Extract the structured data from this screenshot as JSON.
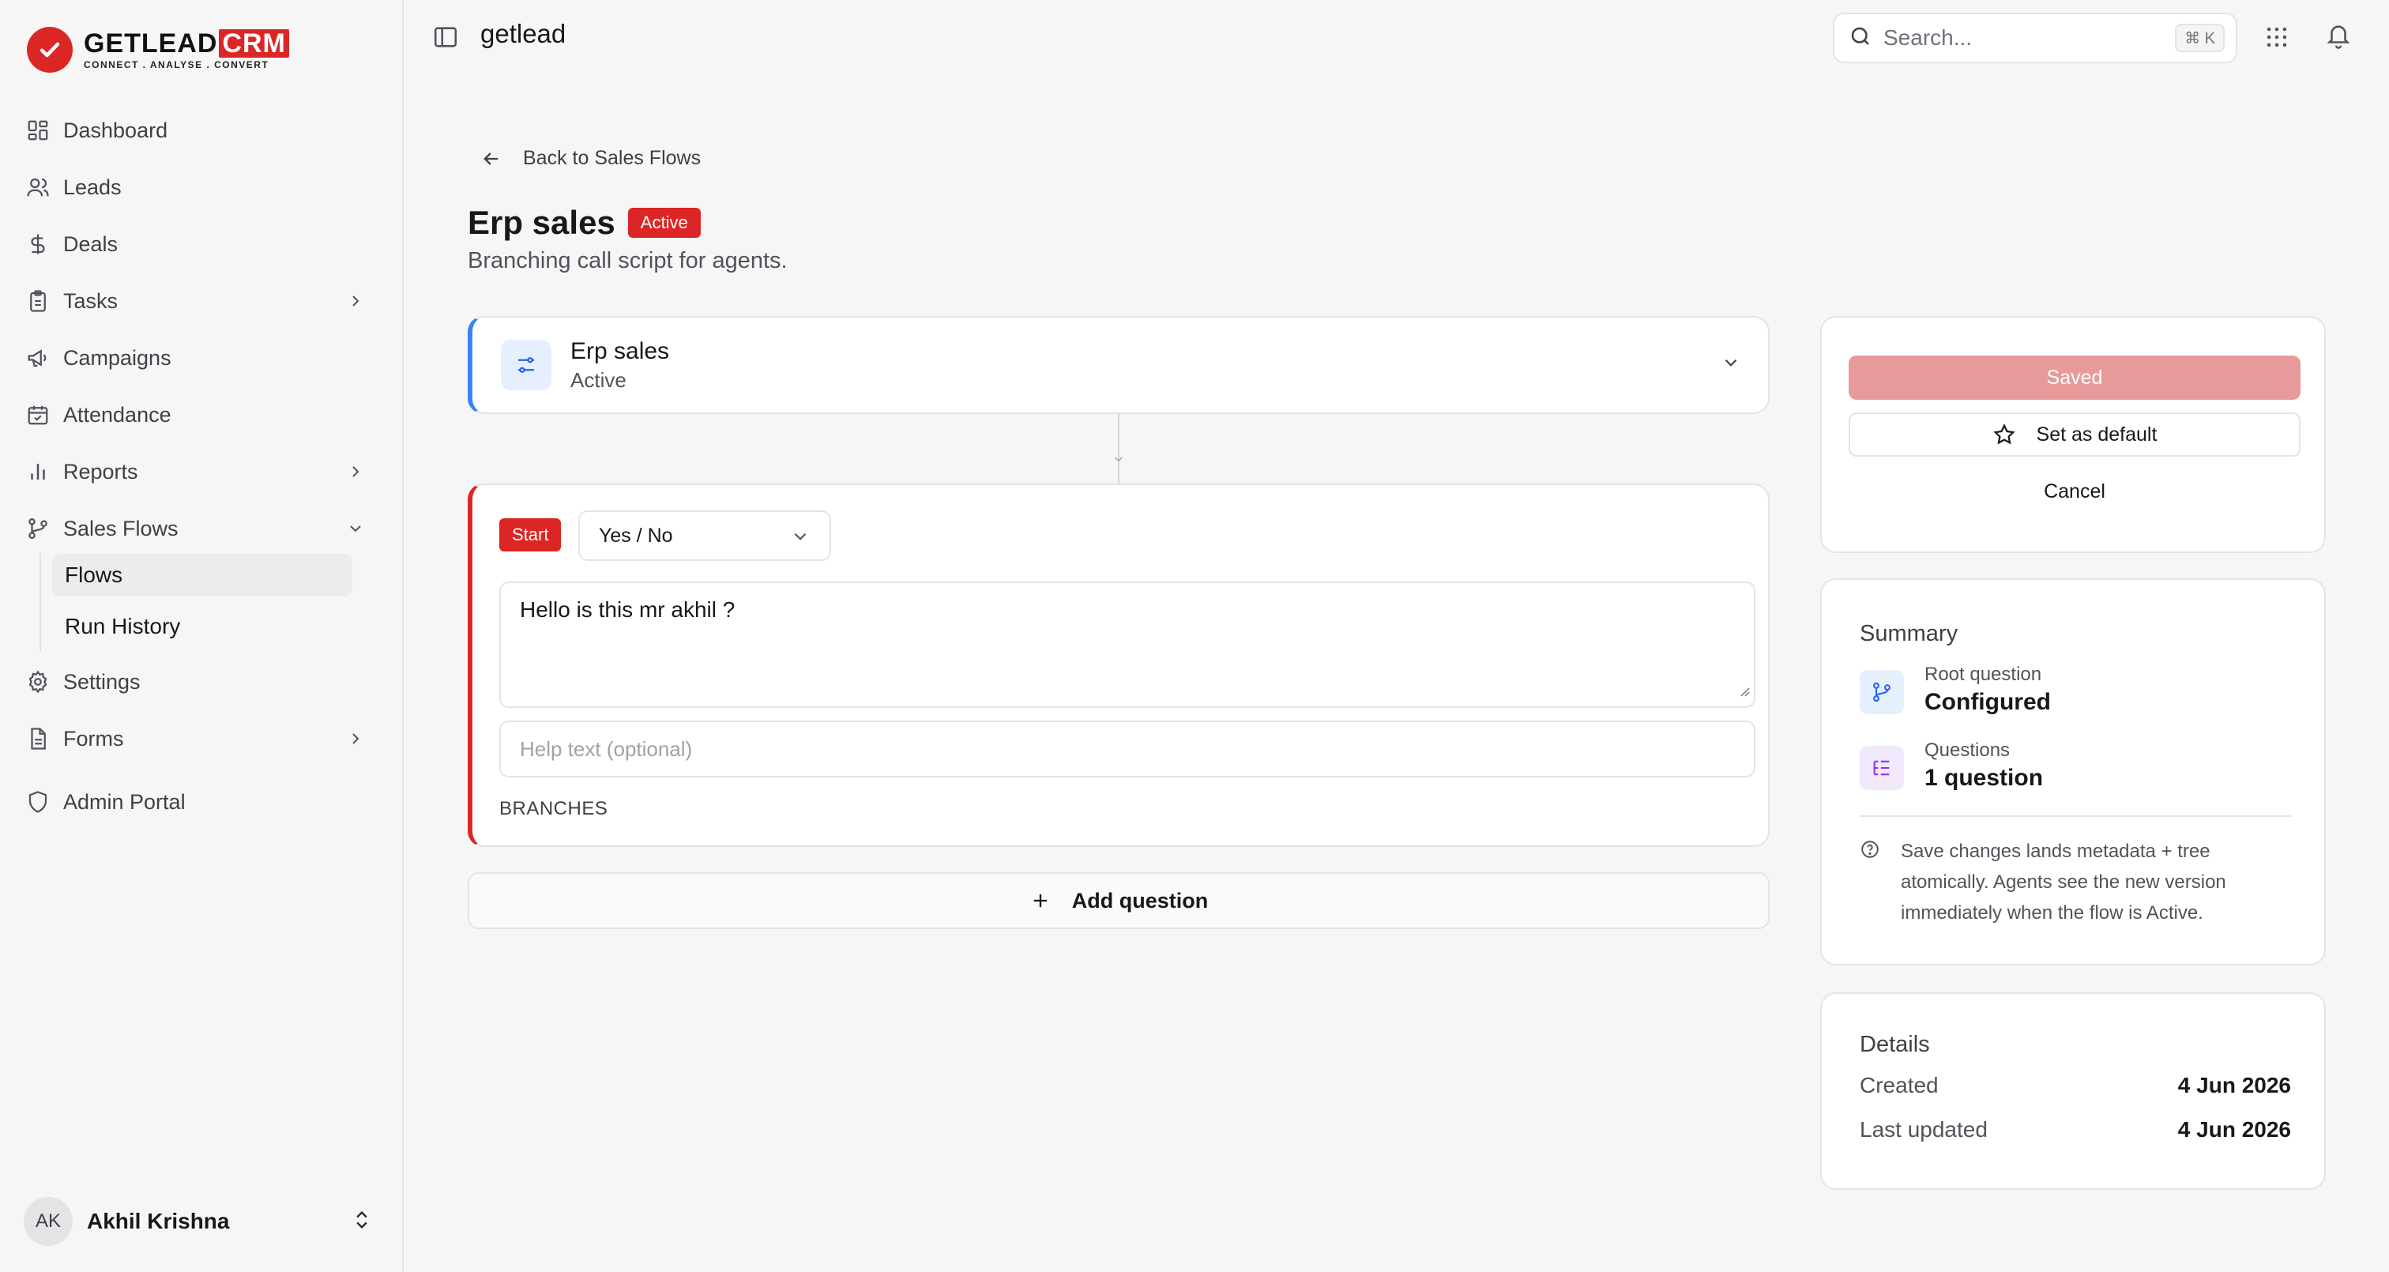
{
  "brand": {
    "logo_word": "GETLEAD",
    "logo_crm": "CRM",
    "logo_tagline": "CONNECT . ANALYSE . CONVERT",
    "workspace_name": "getlead",
    "accent": "#dc2626"
  },
  "sidebar": {
    "items": [
      {
        "label": "Dashboard",
        "icon": "grid-icon"
      },
      {
        "label": "Leads",
        "icon": "users-icon"
      },
      {
        "label": "Deals",
        "icon": "dollar-icon"
      },
      {
        "label": "Tasks",
        "icon": "clipboard-icon"
      },
      {
        "label": "Campaigns",
        "icon": "megaphone-icon"
      },
      {
        "label": "Attendance",
        "icon": "calendar-icon"
      },
      {
        "label": "Reports",
        "icon": "bar-chart-icon"
      },
      {
        "label": "Sales Flows",
        "icon": "branch-icon"
      },
      {
        "label": "Settings",
        "icon": "gear-icon"
      },
      {
        "label": "Forms",
        "icon": "document-icon"
      },
      {
        "label": "Admin Portal",
        "icon": "shield-icon"
      }
    ],
    "sub_items": [
      {
        "label": "Flows",
        "active": true
      },
      {
        "label": "Run History",
        "active": false
      }
    ],
    "user": {
      "initials": "AK",
      "name": "Akhil Krishna"
    }
  },
  "topbar": {
    "search_placeholder": "Search...",
    "shortcut": "⌘ K"
  },
  "main": {
    "back_label": "Back to Sales Flows",
    "title": "Erp sales",
    "status_badge": "Active",
    "subtitle": "Branching call script for agents.",
    "flow_card": {
      "name": "Erp sales",
      "status": "Active"
    },
    "question": {
      "start_badge": "Start",
      "type_value": "Yes / No",
      "text": "Hello is this mr akhil ?",
      "help_placeholder": "Help text (optional)",
      "branches_label": "BRANCHES"
    },
    "add_question_label": "Add question"
  },
  "actions": {
    "saved_label": "Saved",
    "set_default_label": "Set as default",
    "cancel_label": "Cancel"
  },
  "summary": {
    "title": "Summary",
    "rows": [
      {
        "label": "Root question",
        "value": "Configured"
      },
      {
        "label": "Questions",
        "value": "1 question"
      }
    ],
    "note": "Save changes lands metadata + tree atomically. Agents see the new version immediately when the flow is Active."
  },
  "details": {
    "title": "Details",
    "rows": [
      {
        "label": "Created",
        "value": "4 Jun 2026"
      },
      {
        "label": "Last updated",
        "value": "4 Jun 2026"
      }
    ]
  }
}
